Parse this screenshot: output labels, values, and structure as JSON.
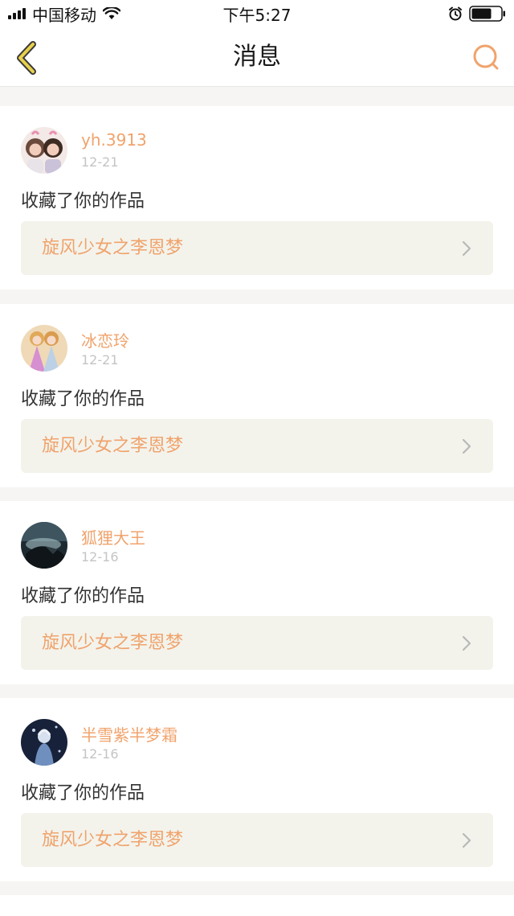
{
  "status_bar": {
    "carrier": "中国移动",
    "time": "下午5:27"
  },
  "nav": {
    "title": "消息",
    "back_icon": "chevron-left-icon",
    "search_icon": "search-icon"
  },
  "colors": {
    "accent": "#f0a36c",
    "back_icon": "#e8d04c",
    "card_link_bg": "#f3f3ec",
    "page_bg": "#f6f5f3"
  },
  "messages": [
    {
      "username": "yh.3913",
      "date": "12-21",
      "action": "收藏了你的作品",
      "work_title": "旋风少女之李恩梦",
      "avatar": "avatar-two-girls"
    },
    {
      "username": "冰恋玲",
      "date": "12-21",
      "action": "收藏了你的作品",
      "work_title": "旋风少女之李恩梦",
      "avatar": "avatar-princess"
    },
    {
      "username": "狐狸大王",
      "date": "12-16",
      "action": "收藏了你的作品",
      "work_title": "旋风少女之李恩梦",
      "avatar": "avatar-dark-scene"
    },
    {
      "username": "半雪紫半梦霜",
      "date": "12-16",
      "action": "收藏了你的作品",
      "work_title": "旋风少女之李恩梦",
      "avatar": "avatar-blue-figure"
    }
  ]
}
